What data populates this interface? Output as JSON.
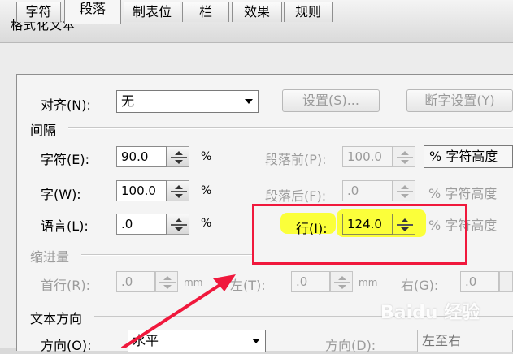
{
  "window": {
    "title": "格式化文本"
  },
  "tabs": [
    {
      "label": "字符"
    },
    {
      "label": "段落"
    },
    {
      "label": "制表位"
    },
    {
      "label": "栏"
    },
    {
      "label": "效果"
    },
    {
      "label": "规则"
    }
  ],
  "active_tab": "段落",
  "align": {
    "label": "对齐(N):",
    "value": "无",
    "settings_button": "设置(S)...",
    "hyphen_button": "断字设置(Y)"
  },
  "spacing": {
    "section": "间隔",
    "char": {
      "label": "字符(E):",
      "value": "90.0",
      "unit": "%"
    },
    "word": {
      "label": "字(W):",
      "value": "100.0",
      "unit": "%"
    },
    "language": {
      "label": "语言(L):",
      "value": ".0",
      "unit": "%"
    },
    "before_para": {
      "label": "段落前(P):",
      "value": "100.0",
      "unit": "% 字符高度"
    },
    "after_para": {
      "label": "段落后(F):",
      "value": ".0",
      "unit": "% 字符高度"
    },
    "line": {
      "label": "行(I):",
      "value": "124.0",
      "unit": "% 字符高度"
    }
  },
  "indent": {
    "section": "缩进量",
    "first_line": {
      "label": "首行(R):",
      "value": ".0",
      "unit": "mm"
    },
    "left": {
      "label": "左(T):",
      "value": ".0",
      "unit": "mm"
    },
    "right": {
      "label": "右(G):",
      "value": ".0"
    }
  },
  "text_direction": {
    "section": "文本方向",
    "direction": {
      "label": "方向(O):",
      "value": "水平"
    },
    "direction2": {
      "label": "方向(D):",
      "value": "左至右"
    }
  },
  "watermark": "Baidu 经验",
  "colors": {
    "annotation_red": "#f0183c",
    "highlight_yellow": "#fbff3a"
  }
}
